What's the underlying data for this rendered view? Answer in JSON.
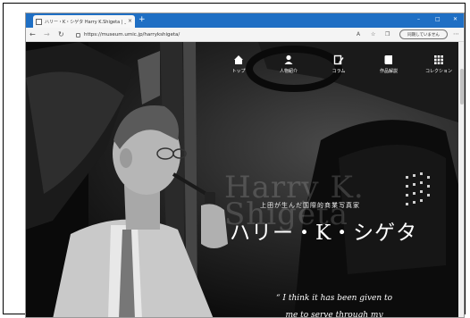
{
  "browser": {
    "tab_title": "ハリー・K・シゲタ Harry K.Shigeta | 上",
    "tab_close": "×",
    "new_tab": "+",
    "url": "https://museum.umic.jp/harrykshigeta/",
    "sync_button": "同期していません",
    "window_min": "–",
    "window_max": "□",
    "window_close": "✕"
  },
  "nav_menu": [
    {
      "label": "トップ",
      "icon": "home-icon"
    },
    {
      "label": "人物紹介",
      "icon": "person-icon"
    },
    {
      "label": "コラム",
      "icon": "edit-icon"
    },
    {
      "label": "作品解説",
      "icon": "book-icon"
    },
    {
      "label": "コレクション",
      "icon": "grid-icon"
    }
  ],
  "hero": {
    "ghost_text": "Harry K. Shigeta",
    "subtitle": "上田が生んだ国際的商業写真家",
    "title": "ハリー・K・シゲタ",
    "quote_line1": "“ I think it has been given to",
    "quote_line2": "me to serve through my"
  },
  "colors": {
    "tabbar": "#1f6fc4",
    "page_bg": "#111111",
    "text": "#ffffff"
  }
}
